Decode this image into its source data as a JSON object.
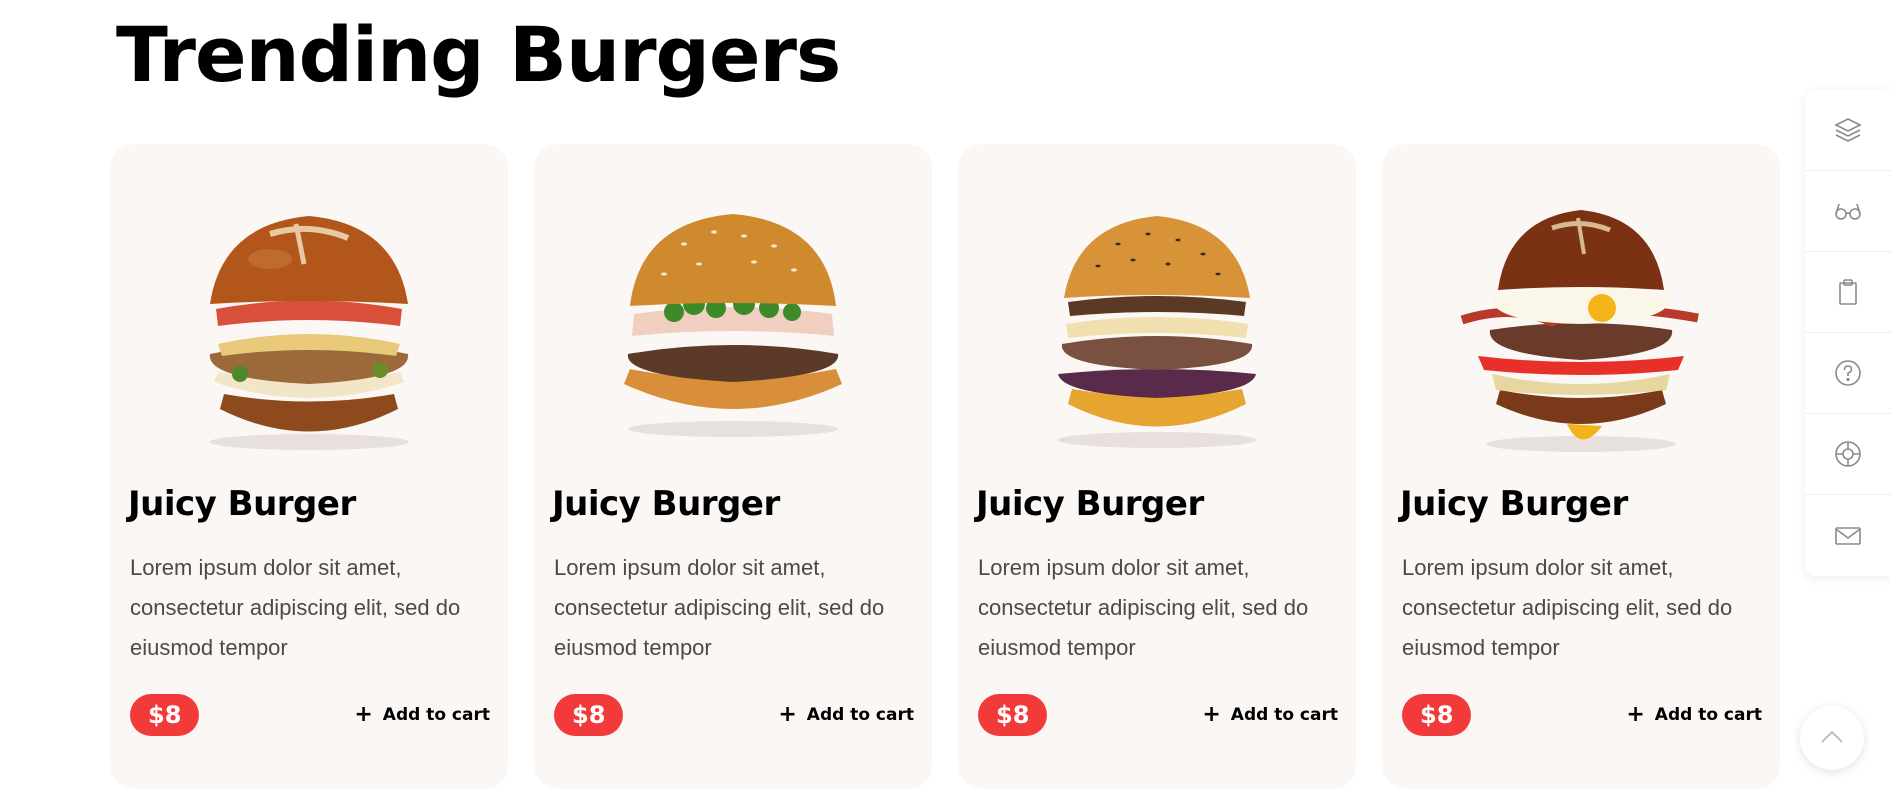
{
  "page": {
    "title": "Trending Burgers"
  },
  "colors": {
    "accent": "#f23a3a",
    "card_bg": "#fbf7f5",
    "icon_gray": "#8a8a8a"
  },
  "cards": [
    {
      "title": "Juicy Burger",
      "description": "Lorem ipsum dolor sit amet, consectetur adipiscing elit, sed do eiusmod tempor",
      "price": "$8",
      "cta": "Add to cart",
      "image": "pretzel-bun-burger"
    },
    {
      "title": "Juicy Burger",
      "description": "Lorem ipsum dolor sit amet, consectetur adipiscing elit, sed do eiusmod tempor",
      "price": "$8",
      "cta": "Add to cart",
      "image": "sesame-bun-burger"
    },
    {
      "title": "Juicy Burger",
      "description": "Lorem ipsum dolor sit amet, consectetur adipiscing elit, sed do eiusmod tempor",
      "price": "$8",
      "cta": "Add to cart",
      "image": "mushroom-burger"
    },
    {
      "title": "Juicy Burger",
      "description": "Lorem ipsum dolor sit amet, consectetur adipiscing elit, sed do eiusmod tempor",
      "price": "$8",
      "cta": "Add to cart",
      "image": "egg-bacon-burger"
    }
  ],
  "side_panel": {
    "icons": [
      "layers-icon",
      "glasses-icon",
      "clipboard-icon",
      "help-circle-icon",
      "lifebuoy-icon",
      "mail-icon"
    ]
  },
  "scroll_top": {
    "icon": "chevron-up-icon"
  }
}
